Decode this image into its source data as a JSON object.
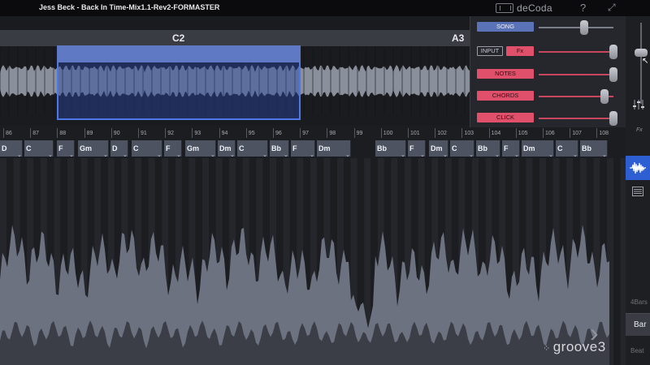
{
  "window": {
    "title": "Jess Beck - Back In Time-Mix1.1-Rev2-FORMASTER",
    "brand": "deCoda",
    "help_icon": "?",
    "expand_icon": "⤢"
  },
  "overview": {
    "sections": [
      {
        "label": "C2",
        "selected": true
      },
      {
        "label": "A3",
        "selected": false
      }
    ]
  },
  "mixer": {
    "channels": [
      {
        "label": "SONG",
        "style": "blue",
        "level": 0.62
      },
      {
        "label": "INPUT",
        "style": "outline",
        "level": null
      },
      {
        "label": "Fx",
        "style": "red",
        "level": 0.98
      },
      {
        "label": "NOTES",
        "style": "red",
        "level": 0.98
      },
      {
        "label": "CHORDS",
        "style": "red",
        "level": 0.86
      },
      {
        "label": "CLICK",
        "style": "red",
        "level": 0.98
      }
    ],
    "master_level": 0.7,
    "fx_label": "Fx"
  },
  "ruler": {
    "bars": [
      "86",
      "87",
      "88",
      "89",
      "90",
      "91",
      "92",
      "93",
      "94",
      "95",
      "96",
      "97",
      "98",
      "99",
      "100",
      "101",
      "102",
      "103",
      "104",
      "105",
      "106",
      "107",
      "108"
    ]
  },
  "chords": [
    "D",
    "C",
    "F",
    "Gm",
    "D",
    "C",
    "F",
    "Gm",
    "Dm",
    "C",
    "Bb",
    "F",
    "Dm",
    "Bb",
    "F",
    "Dm",
    "C",
    "Bb",
    "F",
    "Dm",
    "C",
    "Bb"
  ],
  "sidebar": {
    "bars_label": "4Bars",
    "bar_label": "Bar",
    "beat_label": "Beat"
  },
  "watermark": "groove3",
  "colors": {
    "accent_blue": "#2d5fd2",
    "selection_blue": "#4e78e6",
    "red_button": "#e0506a",
    "chord_block": "#4e5362"
  }
}
